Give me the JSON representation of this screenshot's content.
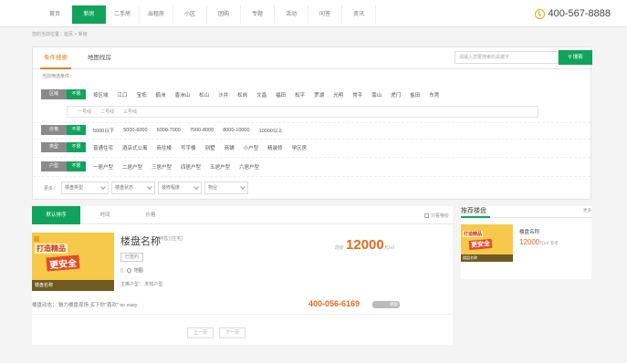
{
  "nav": {
    "items": [
      "首页",
      "新房",
      "二手房",
      "出租房",
      "小区",
      "团购",
      "专题",
      "活动",
      "问答",
      "资讯"
    ],
    "active_index": 1,
    "phone": "400-567-8888"
  },
  "breadcrumb": "您的当前位置：首页 > 新房",
  "panel": {
    "tabs": [
      "条件搜索",
      "地图找房"
    ],
    "search_placeholder": "请输入您要搜索的关键字",
    "search_button": "搜索",
    "condition_label": "当前筛选条件：",
    "area": {
      "label": "区域",
      "all": "不限",
      "options": [
        "按区域",
        "江口",
        "宝坻",
        "鹤洲",
        "香洲山",
        "松山",
        "沙井",
        "松岗",
        "文昌",
        "福田",
        "松平",
        "罗湖",
        "光明",
        "常平",
        "南山",
        "虎门",
        "盐田",
        "东莞"
      ],
      "sub_options": [
        "一号线",
        "二号线",
        "三号线"
      ]
    },
    "price": {
      "label": "价格",
      "all": "不限",
      "options": [
        "5000以下",
        "5000-6000",
        "6000-7000",
        "7000-8000",
        "8000-10000",
        "10000以上"
      ]
    },
    "type": {
      "label": "类型",
      "all": "不限",
      "options": [
        "普通住宅",
        "酒店式公寓",
        "商住楼",
        "写字楼",
        "别墅",
        "商铺",
        "小户型",
        "精装修",
        "学区房"
      ]
    },
    "layout": {
      "label": "户型",
      "all": "不限",
      "options": [
        "一居户型",
        "二居户型",
        "三居户型",
        "四居户型",
        "五居户型",
        "六居户型"
      ]
    },
    "more": {
      "label": "更多：",
      "selects": [
        "楼盘类型",
        "楼盘状态",
        "装修程度",
        "物业"
      ]
    }
  },
  "results": {
    "sort_tabs": [
      "默认排序",
      "时间",
      "价格"
    ],
    "bargain_label": "只看特价",
    "listing": {
      "thumb_line1": "打造精品",
      "thumb_line2": "更安全",
      "thumb_caption": "楼盘名称",
      "name": "楼盘名称",
      "subtitle": "[待售] [住宅]",
      "badge": "已签约",
      "location": "地图",
      "main_type": "主推户型：  未知户型",
      "price_label": "均价",
      "price_value": "12000",
      "price_unit": "元/㎡",
      "dynamic": "楼盘动态：   魅力楼盘现场 买下你\"喜欢\"  so easy",
      "tel": "400-056-6169",
      "tel_badge": "转接"
    },
    "pager": {
      "prev": "上一页",
      "next": "下一页"
    }
  },
  "sidebar": {
    "title": "推荐楼盘",
    "more": "更多",
    "item": {
      "thumb_line1": "打造精品",
      "thumb_line2": "更安全",
      "thumb_caption": "楼盘名称",
      "name": "楼盘名称",
      "price": "12000",
      "unit": "元/㎡ 参考"
    }
  }
}
